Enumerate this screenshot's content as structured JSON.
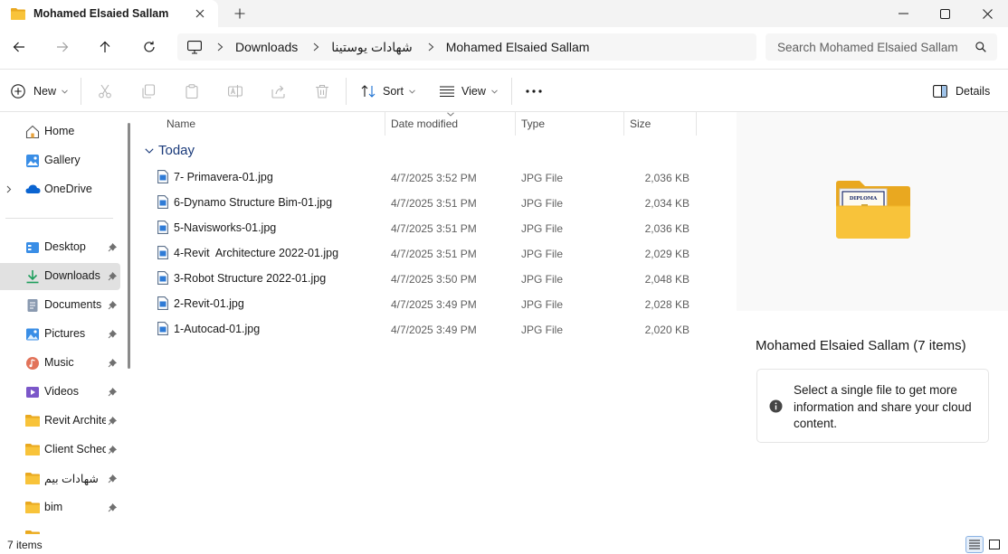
{
  "window": {
    "tab_title": "Mohamed Elsaied Sallam"
  },
  "breadcrumb": [
    "Downloads",
    "شهادات يوستينا",
    "Mohamed Elsaied Sallam"
  ],
  "search": {
    "placeholder": "Search Mohamed Elsaied Sallam"
  },
  "toolbar": {
    "new_label": "New",
    "sort_label": "Sort",
    "view_label": "View",
    "details_label": "Details"
  },
  "sidebar": {
    "items": [
      {
        "label": "Home",
        "icon": "home-icon"
      },
      {
        "label": "Gallery",
        "icon": "gallery-icon"
      },
      {
        "label": "OneDrive",
        "icon": "onedrive-icon"
      },
      {
        "label": "Desktop",
        "icon": "desktop-icon"
      },
      {
        "label": "Downloads",
        "icon": "downloads-icon"
      },
      {
        "label": "Documents",
        "icon": "documents-icon"
      },
      {
        "label": "Pictures",
        "icon": "pictures-icon"
      },
      {
        "label": "Music",
        "icon": "music-icon"
      },
      {
        "label": "Videos",
        "icon": "videos-icon"
      },
      {
        "label": "Revit Architecture",
        "icon": "folder-icon"
      },
      {
        "label": "Client Schedule",
        "icon": "folder-icon"
      },
      {
        "label": "شهادات بيم",
        "icon": "folder-icon"
      },
      {
        "label": "bim",
        "icon": "folder-icon"
      }
    ]
  },
  "columns": {
    "name": "Name",
    "date": "Date modified",
    "type": "Type",
    "size": "Size"
  },
  "group_label": "Today",
  "files": [
    {
      "name": "7- Primavera-01.jpg",
      "date": "4/7/2025 3:52 PM",
      "type": "JPG File",
      "size": "2,036 KB"
    },
    {
      "name": "6-Dynamo Structure Bim-01.jpg",
      "date": "4/7/2025 3:51 PM",
      "type": "JPG File",
      "size": "2,034 KB"
    },
    {
      "name": "5-Navisworks-01.jpg",
      "date": "4/7/2025 3:51 PM",
      "type": "JPG File",
      "size": "2,036 KB"
    },
    {
      "name": "4-Revit  Architecture 2022-01.jpg",
      "date": "4/7/2025 3:51 PM",
      "type": "JPG File",
      "size": "2,029 KB"
    },
    {
      "name": "3-Robot Structure 2022-01.jpg",
      "date": "4/7/2025 3:50 PM",
      "type": "JPG File",
      "size": "2,048 KB"
    },
    {
      "name": "2-Revit-01.jpg",
      "date": "4/7/2025 3:49 PM",
      "type": "JPG File",
      "size": "2,028 KB"
    },
    {
      "name": "1-Autocad-01.jpg",
      "date": "4/7/2025 3:49 PM",
      "type": "JPG File",
      "size": "2,020 KB"
    }
  ],
  "details": {
    "preview_label": "DIPLOMA",
    "title": "Mohamed Elsaied Sallam (7 items)",
    "info": "Select a single file to get more information and share your cloud content."
  },
  "status": {
    "count": "7 items"
  },
  "colors": {
    "accent": "#0067c0",
    "folder": "#f8c33a",
    "selected_bg": "#e1e1e1"
  }
}
